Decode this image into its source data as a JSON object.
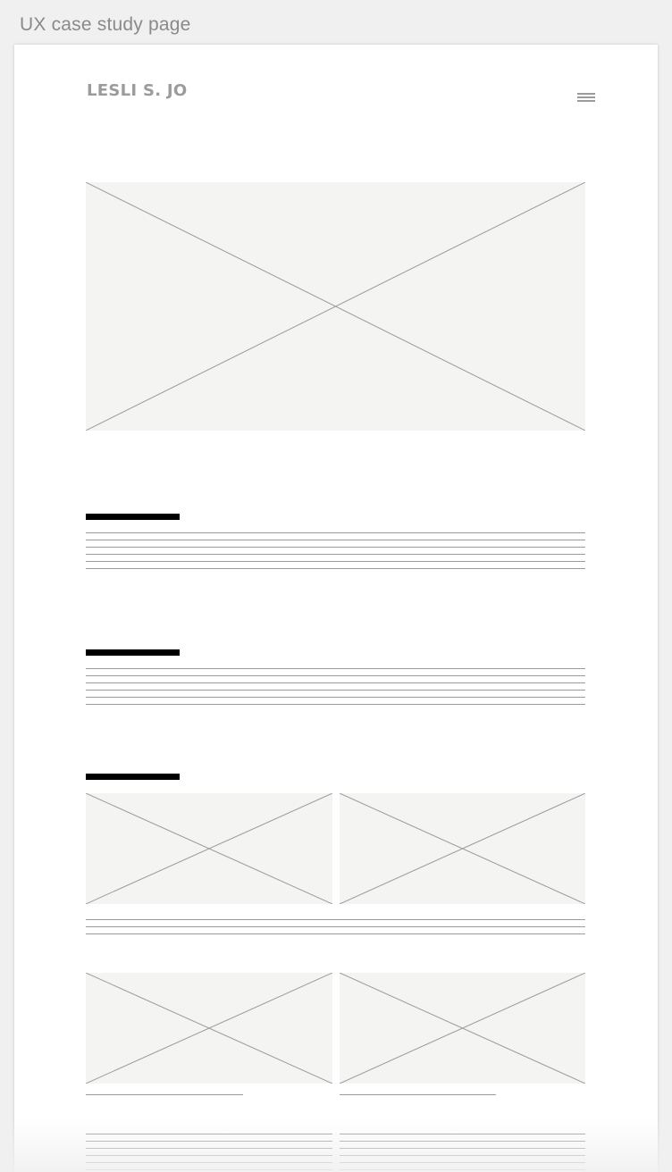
{
  "frame": {
    "label": "UX case study page"
  },
  "header": {
    "logo": "LESLI S. JO",
    "menu_icon": "hamburger-menu-icon"
  },
  "colors": {
    "placeholder_fill": "#f4f4f2",
    "line": "#9a9a9a",
    "heading_bar": "#000000",
    "logo": "#9b9b9b"
  },
  "icons": {
    "image_placeholder": "crossed-box-icon"
  }
}
